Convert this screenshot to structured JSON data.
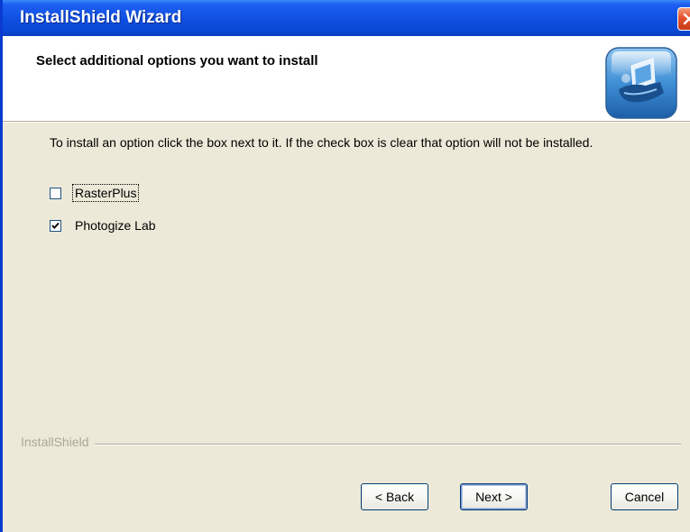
{
  "window": {
    "title": "InstallShield Wizard",
    "close_icon": "close-x-icon"
  },
  "header": {
    "title": "Select additional options you want to install",
    "icon": "computer-install-icon"
  },
  "body": {
    "instructions": "To install an option click the box next to it. If the check box is clear that option will not be installed.",
    "options": [
      {
        "label": "RasterPlus",
        "checked": false,
        "focused": true
      },
      {
        "label": "Photogize Lab",
        "checked": true,
        "focused": false
      }
    ]
  },
  "footer": {
    "brand": "InstallShield",
    "back_label": "< Back",
    "next_label": "Next >",
    "cancel_label": "Cancel"
  },
  "colors": {
    "titlebar": "#0a48d6",
    "dialog_bg": "#ece9d8",
    "header_bg": "#ffffff",
    "close_button": "#e3512b"
  }
}
